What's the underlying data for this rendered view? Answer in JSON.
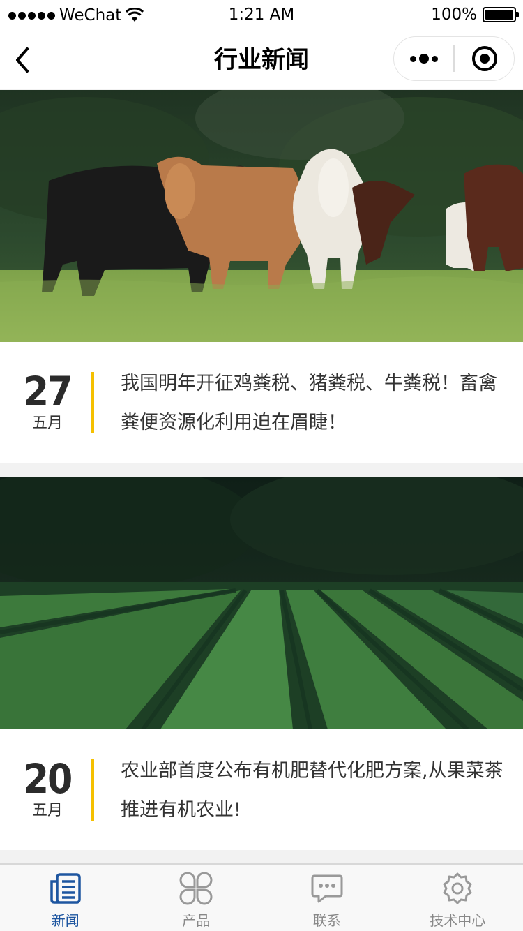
{
  "status_bar": {
    "carrier": "WeChat",
    "time": "1:21 AM",
    "battery": "100%",
    "battery_level": 1.0,
    "signal_icon": "signal-dots-icon",
    "wifi_icon": "wifi-icon"
  },
  "nav": {
    "title": "行业新闻",
    "back_icon": "chevron-left-icon",
    "menu_icon": "more-dots-icon",
    "close_icon": "target-circle-icon"
  },
  "news": [
    {
      "day": "27",
      "month": "五月",
      "title": "我国明年开征鸡粪税、猪粪税、牛粪税！畜禽粪便资源化利用迫在眉睫！",
      "image": "cattle-pasture-photo"
    },
    {
      "day": "20",
      "month": "五月",
      "title": "农业部首度公布有机肥替代化肥方案,从果菜茶推进有机农业!",
      "image": "tea-field-photo"
    }
  ],
  "tabs": [
    {
      "label": "新闻",
      "icon": "news-list-icon",
      "active": true
    },
    {
      "label": "产品",
      "icon": "grid-clover-icon",
      "active": false
    },
    {
      "label": "联系",
      "icon": "chat-bubble-icon",
      "active": false
    },
    {
      "label": "技术中心",
      "icon": "gear-icon",
      "active": false
    }
  ],
  "colors": {
    "accent": "#f5c000",
    "active_tab": "#1e56a0",
    "inactive_tab": "#888888"
  }
}
